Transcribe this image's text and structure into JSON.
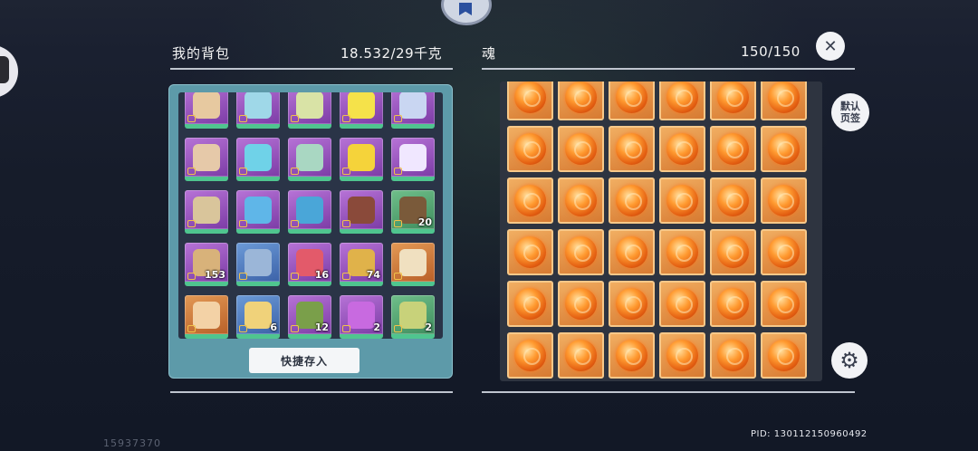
{
  "bag": {
    "title": "我的背包",
    "weight": "18.532/29千克",
    "quick_store_label": "快捷存入",
    "items": [
      {
        "rarity": "purple",
        "icon": "weapon-axe-icon",
        "count": ""
      },
      {
        "rarity": "purple",
        "icon": "weapon-lance-icon",
        "count": ""
      },
      {
        "rarity": "purple",
        "icon": "weapon-scythe-icon",
        "count": ""
      },
      {
        "rarity": "purple",
        "icon": "weapon-mace-icon",
        "count": ""
      },
      {
        "rarity": "purple",
        "icon": "weapon-crossbow-icon",
        "count": ""
      },
      {
        "rarity": "purple",
        "icon": "weapon-bow-icon",
        "count": ""
      },
      {
        "rarity": "purple",
        "icon": "weapon-spear-icon",
        "count": ""
      },
      {
        "rarity": "purple",
        "icon": "parasol-icon",
        "count": ""
      },
      {
        "rarity": "purple",
        "icon": "banana-icon",
        "count": ""
      },
      {
        "rarity": "purple",
        "icon": "drink-cup-icon",
        "count": ""
      },
      {
        "rarity": "purple",
        "icon": "fishing-rod-icon",
        "count": ""
      },
      {
        "rarity": "purple",
        "icon": "ice-blade-icon",
        "count": ""
      },
      {
        "rarity": "purple",
        "icon": "staff-icon",
        "count": ""
      },
      {
        "rarity": "purple",
        "icon": "rifle-icon",
        "count": ""
      },
      {
        "rarity": "green",
        "icon": "tree-stump-icon",
        "count": "20"
      },
      {
        "rarity": "purple",
        "icon": "treasure-map-icon",
        "count": "153"
      },
      {
        "rarity": "blue",
        "icon": "disc-icon",
        "count": ""
      },
      {
        "rarity": "purple",
        "icon": "megaphone-icon",
        "count": "16"
      },
      {
        "rarity": "purple",
        "icon": "trident-banner-icon",
        "count": "74"
      },
      {
        "rarity": "orange",
        "icon": "horn-icon",
        "count": ""
      },
      {
        "rarity": "orange",
        "icon": "cake-icon",
        "count": ""
      },
      {
        "rarity": "blue",
        "icon": "scroll-icon",
        "count": "6"
      },
      {
        "rarity": "purple",
        "icon": "gadget-icon",
        "count": "12"
      },
      {
        "rarity": "purple",
        "icon": "crystal-box-icon",
        "count": "2"
      },
      {
        "rarity": "green",
        "icon": "wreath-icon",
        "count": "2"
      }
    ]
  },
  "soul": {
    "title": "魂",
    "capacity": "150/150",
    "slot_icon": "soul-orb-icon"
  },
  "side": {
    "default_tab_line1": "默认",
    "default_tab_line2": "页签",
    "close_icon": "close-icon",
    "settings_icon": "gear-icon"
  },
  "footer": {
    "pid": "PID: 130112150960492",
    "uid": "15937370"
  },
  "colors": {
    "panel_teal": "#5d9aa9",
    "rarity_purple": "#9a55c2",
    "orb_orange": "#e25c10"
  }
}
